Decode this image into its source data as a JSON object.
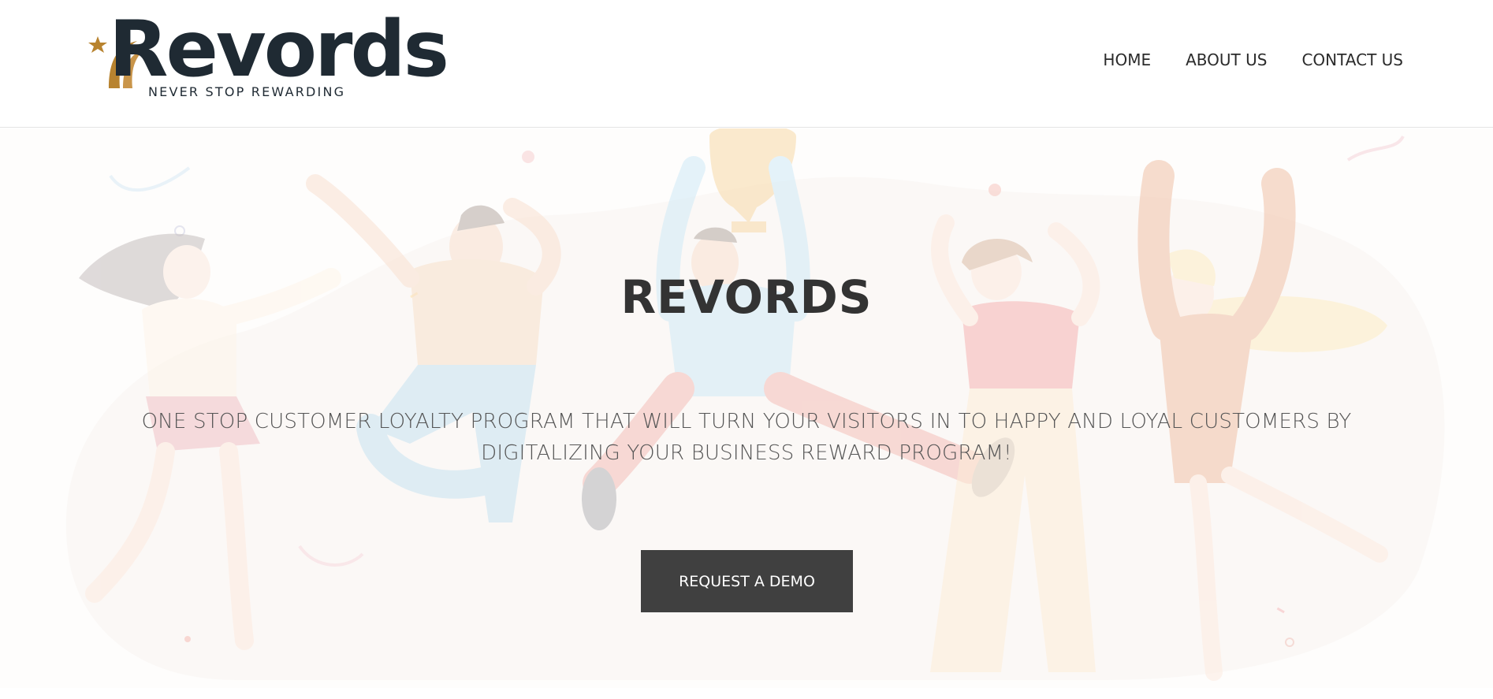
{
  "brand": {
    "name": "Revords",
    "tagline": "NEVER STOP REWARDING",
    "colors": {
      "dark": "#1f2a33",
      "gold": "#b8832f"
    }
  },
  "nav": {
    "items": [
      {
        "label": "HOME"
      },
      {
        "label": "ABOUT US"
      },
      {
        "label": "CONTACT US"
      }
    ]
  },
  "hero": {
    "title": "REVORDS",
    "subtitle": "ONE STOP CUSTOMER LOYALTY PROGRAM THAT WILL TURN YOUR VISITORS IN TO HAPPY AND LOYAL CUSTOMERS BY DIGITALIZING YOUR BUSINESS REWARD PROGRAM!",
    "cta_label": "REQUEST A DEMO",
    "cta_color": "#404040",
    "illustration": "celebrating-people-with-trophy-illustration"
  }
}
